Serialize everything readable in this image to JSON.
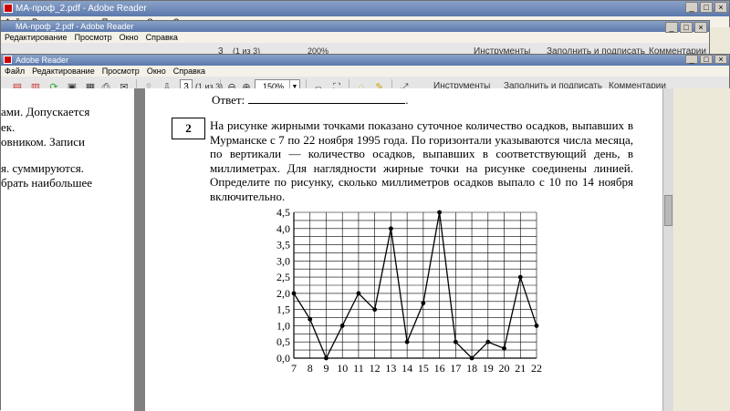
{
  "window1": {
    "title": "МА-проф_2.pdf - Adobe Reader",
    "menu": [
      "Файл",
      "Редактирование",
      "Просмотр",
      "Окно",
      "Справка"
    ]
  },
  "window2": {
    "title": "МА-проф_2.pdf - Adobe Reader",
    "menu": [
      "Редактирование",
      "Просмотр",
      "Окно",
      "Справка"
    ],
    "page": "3",
    "page_count": "(1 из 3)",
    "zoom": "200%",
    "tools_label": "Инструменты",
    "fill_sign_label": "Заполнить и подписать",
    "comments_label": "Комментарии"
  },
  "window3": {
    "title": "Adobe Reader",
    "menu": [
      "Файл",
      "Редактирование",
      "Просмотр",
      "Окно",
      "Справка"
    ],
    "page": "3",
    "page_count": "(1 из 3)",
    "zoom": "150%",
    "tools_label": "Инструменты",
    "fill_sign_label": "Заполнить и подписать",
    "comments_label": "Комментарии"
  },
  "left_page_lines": [
    "ами. Допускается",
    "ек.",
    "овником. Записи",
    "я. суммируются.",
    "брать наибольшее"
  ],
  "document": {
    "answer_label": "Ответ:",
    "answer_end": ".",
    "question_number": "2",
    "question_text": "На рисунке жирными точками показано суточное количество осадков, выпавших в Мурманске с 7 по 22 ноября 1995 года. По горизонтали указываются числа месяца, по вертикали — количество осадков, выпавших в соответствующий день, в миллиметрах. Для наглядности жирные точки на рисунке соединены линией. Определите по рисунку, сколько миллиметров осадков выпало с 10 по 14 ноября включительно."
  },
  "chart_data": {
    "type": "line",
    "title": "",
    "xlabel": "",
    "ylabel": "",
    "x": [
      7,
      8,
      9,
      10,
      11,
      12,
      13,
      14,
      15,
      16,
      17,
      18,
      19,
      20,
      21,
      22
    ],
    "series": [
      {
        "values": [
          2.0,
          1.2,
          0.0,
          1.0,
          2.0,
          1.5,
          4.0,
          0.5,
          1.7,
          4.5,
          0.5,
          0.0,
          0.5,
          0.3,
          2.5,
          1.0
        ]
      }
    ],
    "y_ticks": [
      "0,0",
      "0,5",
      "1,0",
      "1,5",
      "2,0",
      "2,5",
      "3,0",
      "3,5",
      "4,0",
      "4,5"
    ],
    "x_ticks": [
      "7",
      "8",
      "9",
      "10",
      "11",
      "12",
      "13",
      "14",
      "15",
      "16",
      "17",
      "18",
      "19",
      "20",
      "21",
      "22"
    ],
    "ylim": [
      0,
      4.5
    ],
    "y_minor_step": 0.25,
    "grid": true,
    "line_color": "#000000"
  }
}
